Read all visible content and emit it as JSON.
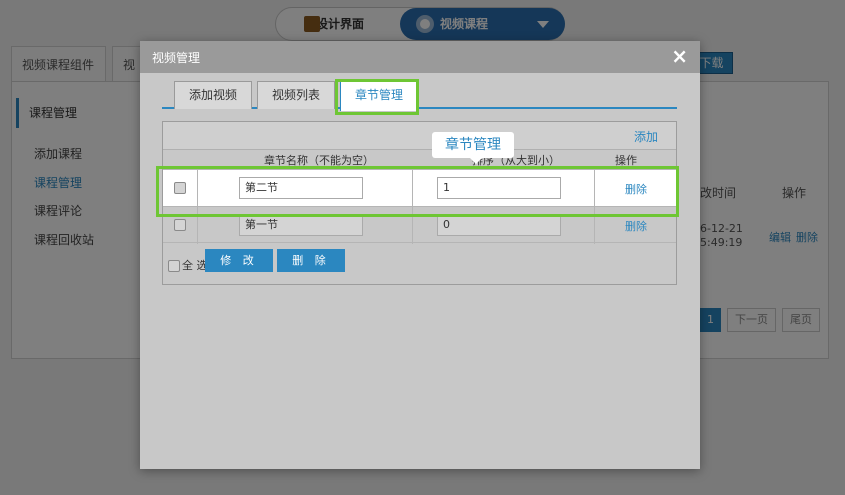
{
  "topbar": {
    "design_label": "设计界面",
    "video_label": "视频课程"
  },
  "background": {
    "tabs": [
      "视频课程组件",
      "视"
    ],
    "download_label": "下载",
    "sidebar_title": "课程管理",
    "sidebar_items": [
      "添加课程",
      "课程管理",
      "课程评论",
      "课程回收站"
    ],
    "table_headers": [
      "改时间",
      "操作"
    ],
    "row": {
      "date": "6-12-21",
      "time": "5:49:19",
      "edit": "编辑",
      "delete": "删除"
    },
    "pagination": [
      "1",
      "下一页",
      "尾页"
    ]
  },
  "modal": {
    "title": "视频管理",
    "close": "×",
    "tabs": [
      "添加视频",
      "视频列表",
      "章节管理"
    ],
    "active_tab": "章节管理",
    "add_link": "添加",
    "headers": [
      "章节名称（不能为空）",
      "排序（从大到小）",
      "操作"
    ],
    "rows": [
      {
        "name": "第二节",
        "order": "1",
        "action": "删除"
      },
      {
        "name": "第一节",
        "order": "0",
        "action": "删除"
      }
    ],
    "select_all": "全 选",
    "edit_button": "修 改",
    "delete_button": "删 除"
  },
  "annotation": {
    "tooltip": "章节管理",
    "highlight_color": "#6ec634"
  },
  "colors": {
    "accent": "#2b87c0",
    "highlight": "#6ec634"
  }
}
